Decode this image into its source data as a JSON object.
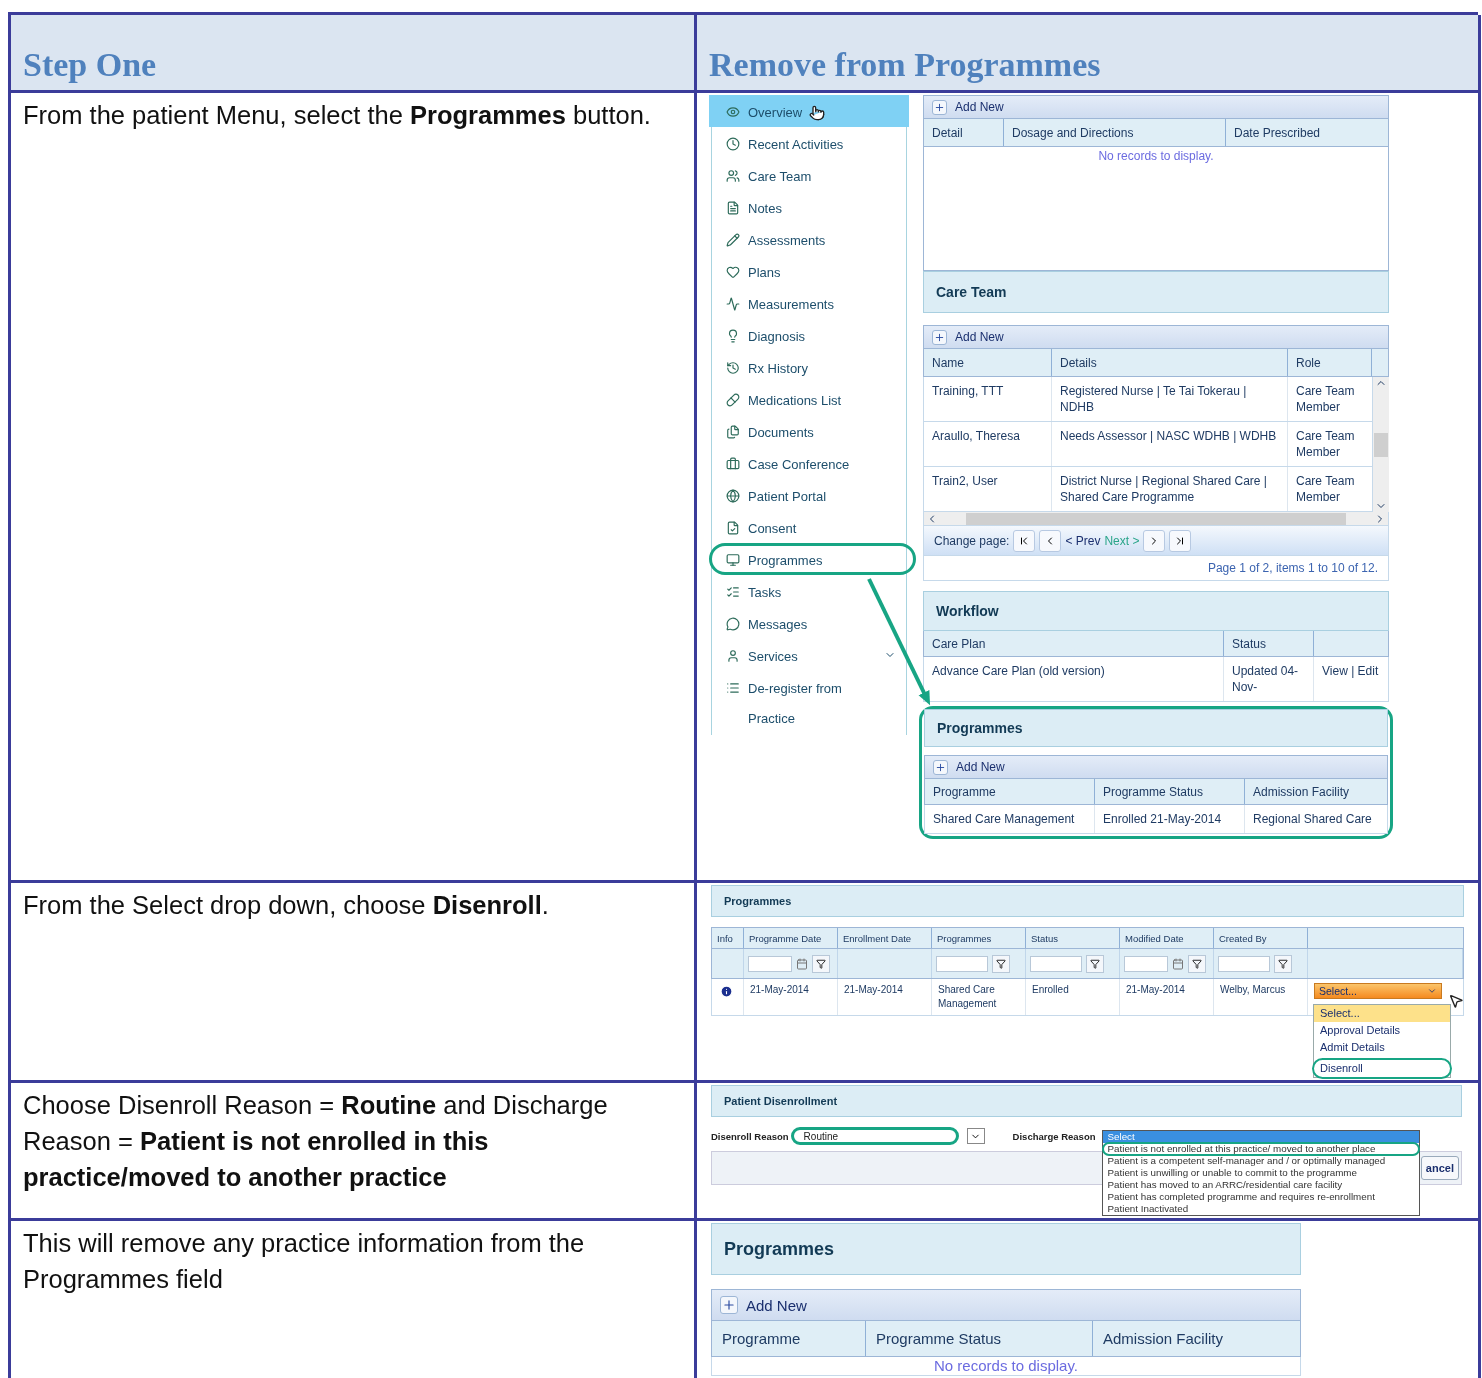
{
  "header": {
    "left": "Step One",
    "right": "Remove from Programmes"
  },
  "steps": [
    {
      "instruction": "From the patient Menu, select the **Programmes** button.",
      "kind": "overview",
      "nav": [
        {
          "label": "Overview",
          "selected": true,
          "highlighted": false,
          "expandable": false
        },
        {
          "label": "Recent Activities",
          "selected": false,
          "highlighted": false,
          "expandable": false
        },
        {
          "label": "Care Team",
          "selected": false,
          "highlighted": false,
          "expandable": false
        },
        {
          "label": "Notes",
          "selected": false,
          "highlighted": false,
          "expandable": false
        },
        {
          "label": "Assessments",
          "selected": false,
          "highlighted": false,
          "expandable": false
        },
        {
          "label": "Plans",
          "selected": false,
          "highlighted": false,
          "expandable": false
        },
        {
          "label": "Measurements",
          "selected": false,
          "highlighted": false,
          "expandable": false
        },
        {
          "label": "Diagnosis",
          "selected": false,
          "highlighted": false,
          "expandable": false
        },
        {
          "label": "Rx History",
          "selected": false,
          "highlighted": false,
          "expandable": false
        },
        {
          "label": "Medications List",
          "selected": false,
          "highlighted": false,
          "expandable": false
        },
        {
          "label": "Documents",
          "selected": false,
          "highlighted": false,
          "expandable": false
        },
        {
          "label": "Case Conference",
          "selected": false,
          "highlighted": false,
          "expandable": false
        },
        {
          "label": "Patient Portal",
          "selected": false,
          "highlighted": false,
          "expandable": false
        },
        {
          "label": "Consent",
          "selected": false,
          "highlighted": false,
          "expandable": false
        },
        {
          "label": "Programmes",
          "selected": false,
          "highlighted": true,
          "expandable": false
        },
        {
          "label": "Tasks",
          "selected": false,
          "highlighted": false,
          "expandable": false
        },
        {
          "label": "Messages",
          "selected": false,
          "highlighted": false,
          "expandable": false
        },
        {
          "label": "Services",
          "selected": false,
          "highlighted": false,
          "expandable": true
        },
        {
          "label": "De-register from Practice",
          "selected": false,
          "highlighted": false,
          "expandable": false
        }
      ],
      "medications": {
        "add": "Add New",
        "columns": [
          "Detail",
          "Dosage and Directions",
          "Date Prescribed"
        ],
        "empty": "No records to display."
      },
      "care_team": {
        "title": "Care Team",
        "add": "Add New",
        "columns": [
          "Name",
          "Details",
          "Role"
        ],
        "rows": [
          [
            "Training, TTT",
            "Registered Nurse | Te Tai Tokerau | NDHB",
            "Care Team Member"
          ],
          [
            "Araullo, Theresa",
            "Needs Assessor | NASC WDHB | WDHB",
            "Care Team Member"
          ],
          [
            "Train2, User",
            "District Nurse | Regional Shared Care | Shared Care Programme",
            "Care Team Member"
          ]
        ],
        "pager": {
          "label": "Change page:",
          "prev": "< Prev",
          "next": "Next >",
          "summary": "Page 1 of 2, items 1 to 10 of 12."
        }
      },
      "workflow": {
        "title": "Workflow",
        "columns": [
          "Care Plan",
          "Status"
        ],
        "rows": [
          [
            "Advance Care Plan (old version)",
            "Updated 04-Nov-",
            "View | Edit"
          ]
        ]
      },
      "programmes": {
        "title": "Programmes",
        "add": "Add New",
        "highlighted": true,
        "columns": [
          "Programme",
          "Programme Status",
          "Admission Facility"
        ],
        "rows": [
          [
            "Shared Care Management",
            "Enrolled 21-May-2014",
            "Regional Shared Care"
          ]
        ]
      }
    },
    {
      "instruction": "From the Select drop down, choose **Disenroll**.",
      "kind": "grid",
      "title": "Programmes",
      "columns": [
        {
          "label": "Info",
          "kind": "plain"
        },
        {
          "label": "Programme Date",
          "kind": "date"
        },
        {
          "label": "Enrollment Date",
          "kind": "plain"
        },
        {
          "label": "Programmes",
          "kind": "text"
        },
        {
          "label": "Status",
          "kind": "text"
        },
        {
          "label": "Modified Date",
          "kind": "date"
        },
        {
          "label": "Created By",
          "kind": "text"
        }
      ],
      "row": [
        "21-May-2014",
        "21-May-2014",
        "Shared Care Management",
        "Enrolled",
        "21-May-2014",
        "Welby, Marcus"
      ],
      "select": {
        "value": "Select...",
        "options": [
          {
            "label": "Select...",
            "selected": true,
            "highlighted": false
          },
          {
            "label": "Approval Details",
            "selected": false,
            "highlighted": false
          },
          {
            "label": "Admit Details",
            "selected": false,
            "highlighted": false
          },
          {
            "label": "Disenroll",
            "selected": false,
            "highlighted": true
          }
        ]
      }
    },
    {
      "instruction": "Choose Disenroll Reason = **Routine** and Discharge Reason = **Patient is not enrolled in this practice/moved to another practice**",
      "kind": "disenroll",
      "title": "Patient Disenrollment",
      "disenroll_reason": {
        "label": "Disenroll Reason",
        "value": "Routine",
        "highlighted": true
      },
      "discharge_reason": {
        "label": "Discharge Reason",
        "options": [
          {
            "label": "Select",
            "selected": true,
            "highlighted": false
          },
          {
            "label": "Patient is not enrolled at this practice/ moved to another place",
            "selected": false,
            "highlighted": true
          },
          {
            "label": "Patient is a competent self-manager and / or optimally managed",
            "selected": false,
            "highlighted": false
          },
          {
            "label": "Patient is unwilling or unable to commit to the programme",
            "selected": false,
            "highlighted": false
          },
          {
            "label": "Patient has moved to an ARRC/residential care facility",
            "selected": false,
            "highlighted": false
          },
          {
            "label": "Patient has completed programme and requires re-enrollment",
            "selected": false,
            "highlighted": false
          },
          {
            "label": "Patient Inactivated",
            "selected": false,
            "highlighted": false
          }
        ]
      },
      "cancel": "ancel"
    },
    {
      "instruction": "This will remove any practice information from the Programmes field",
      "kind": "result",
      "title": "Programmes",
      "add": "Add New",
      "columns": [
        "Programme",
        "Programme Status",
        "Admission Facility"
      ],
      "empty": "No records to display."
    }
  ]
}
